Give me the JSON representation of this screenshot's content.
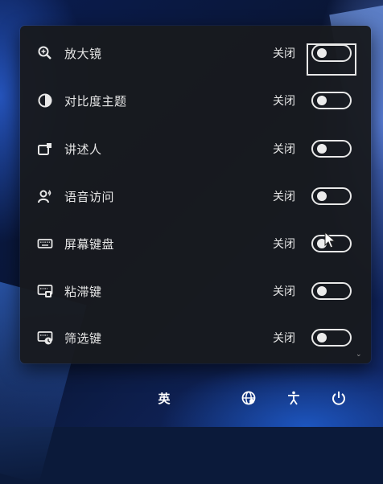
{
  "accessibility_panel": {
    "items": [
      {
        "label": "放大镜",
        "state": "关闭",
        "icon": "magnifier-icon"
      },
      {
        "label": "对比度主题",
        "state": "关闭",
        "icon": "contrast-icon"
      },
      {
        "label": "讲述人",
        "state": "关闭",
        "icon": "narrator-icon"
      },
      {
        "label": "语音访问",
        "state": "关闭",
        "icon": "voice-access-icon"
      },
      {
        "label": "屏幕键盘",
        "state": "关闭",
        "icon": "keyboard-icon"
      },
      {
        "label": "粘滞键",
        "state": "关闭",
        "icon": "sticky-keys-icon"
      },
      {
        "label": "筛选键",
        "state": "关闭",
        "icon": "filter-keys-icon"
      }
    ],
    "toggle_on": false
  },
  "taskbar": {
    "ime_label": "英",
    "network_icon": "network-globe-icon",
    "accessibility_icon": "accessibility-icon",
    "power_icon": "power-icon"
  },
  "colors": {
    "panel_bg": "#181a1e",
    "text": "#e6e6e6",
    "wallpaper_accent": "#2a64d6"
  }
}
